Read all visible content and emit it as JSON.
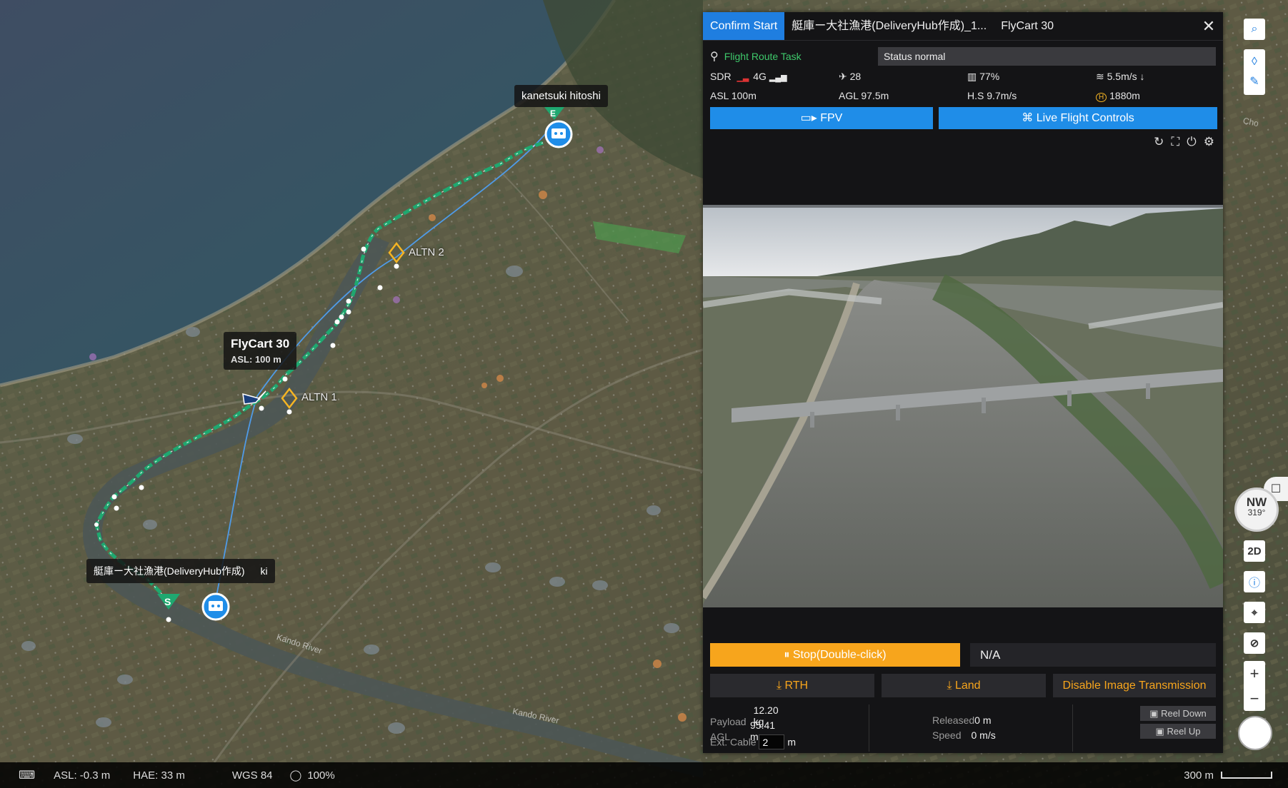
{
  "map": {
    "pilot_label": "kanetsuki hitoshi",
    "aircraft_label": "FlyCart 30",
    "aircraft_asl": "ASL: 100 m",
    "hub_label": "艇庫ー大社漁港(DeliveryHub作成)",
    "hub_label_suffix": "ki",
    "altn1": "ALTN 1",
    "altn2": "ALTN 2",
    "start_marker": "S",
    "end_marker": "E",
    "place_labels": [
      "Kando River",
      "Kando River",
      "Cho"
    ]
  },
  "panel": {
    "tabs": [
      {
        "label": "Confirm Start",
        "active": true
      },
      {
        "label": "艇庫ー大社漁港(DeliveryHub作成)_1..."
      },
      {
        "label": "FlyCart 30"
      }
    ],
    "close_glyph": "✕",
    "task_label": "Flight Route Task",
    "status": "Status normal",
    "stats": {
      "sdr": "SDR",
      "network": "4G",
      "satellites": "28",
      "battery": "77%",
      "vertical_speed": "5.5m/s",
      "asl": "ASL 100m",
      "agl": "AGL 97.5m",
      "hs": "H.S 9.7m/s",
      "home_dist": "1880m"
    },
    "fpv_label": "FPV",
    "live_label": "Live Flight Controls",
    "stop_label": "Stop(Double-click)",
    "na_label": "N/A",
    "rth_label": "RTH",
    "land_label": "Land",
    "disable_label": "Disable Image Transmission",
    "payload": {
      "payload_label": "Payload",
      "payload_value": "12.20 kg",
      "agl_label": "AGL",
      "agl_value": "95.41 m",
      "cable_label": "Ext. Cable",
      "cable_value": "2",
      "cable_unit": "m",
      "released_label": "Released",
      "released_value": "0 m",
      "speed_label": "Speed",
      "speed_value": "0 m/s",
      "reel_down": "Reel Down",
      "reel_up": "Reel Up"
    }
  },
  "toolbar": {
    "compass_dir": "NW",
    "compass_deg": "319°",
    "mode_2d": "2D",
    "zoom_in": "+",
    "zoom_out": "−"
  },
  "statusbar": {
    "asl": "ASL: -0.3 m",
    "hae": "HAE: 33 m",
    "datum": "WGS 84",
    "opacity": "100%",
    "scale": "300 m"
  },
  "colors": {
    "accent": "#1f8de8",
    "route": "#1fa870",
    "stop": "#f7a51c",
    "task": "#3ec96b"
  }
}
